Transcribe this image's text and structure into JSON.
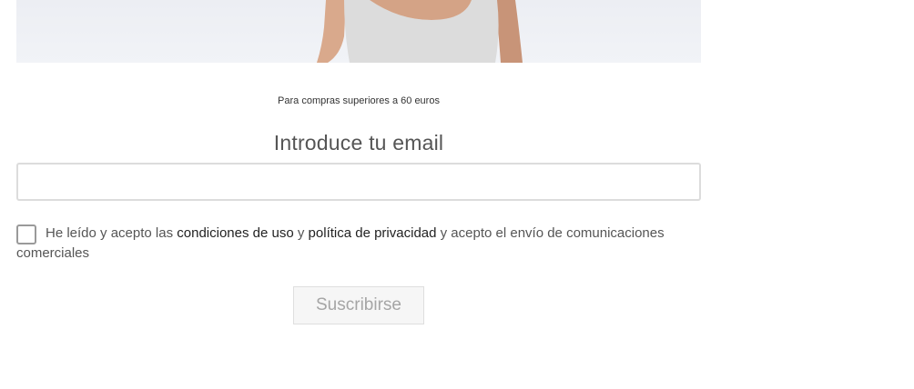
{
  "hero": {
    "image_subject": "model-in-grey-tank-top"
  },
  "promo": {
    "note": "Para compras superiores a 60 euros"
  },
  "signup": {
    "heading": "Introduce tu email",
    "email_value": "",
    "email_placeholder": "",
    "consent": {
      "prefix": "He leído y acepto las ",
      "terms_link": "condiciones de uso",
      "joiner": " y ",
      "privacy_link": "política de privacidad",
      "suffix": " y acepto el envío de comunicaciones comerciales",
      "checked": false
    },
    "subscribe_label": "Suscribirse"
  },
  "colors": {
    "heading": "#555555",
    "link": "#222222",
    "button_bg": "#f6f6f6",
    "button_text": "#a5a5a5",
    "input_border": "#dcdcdc"
  }
}
